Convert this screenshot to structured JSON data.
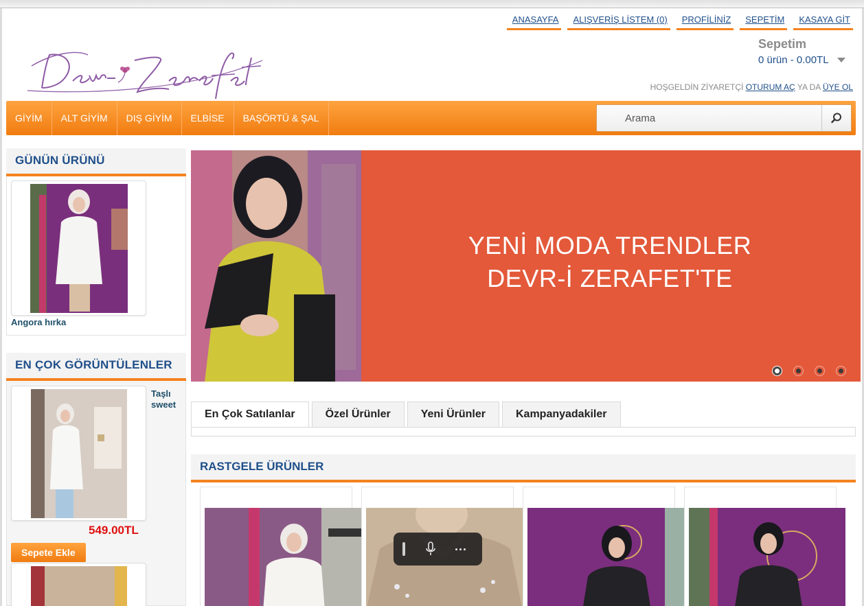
{
  "top_links": [
    {
      "label": "ANASAYFA"
    },
    {
      "label": "ALIŞVERİŞ LİSTEM (0)"
    },
    {
      "label": "PROFİLİNİZ"
    },
    {
      "label": "SEPETİM"
    },
    {
      "label": "KASAYA GİT"
    }
  ],
  "logo": {
    "text": "Devr-i Zerafet"
  },
  "cart": {
    "title": "Sepetim",
    "summary": "0 ürün - 0.00TL"
  },
  "welcome": {
    "prefix": "HOŞGELDİN ZİYARETÇİ",
    "login": "OTURUM AÇ",
    "middle": "YA DA",
    "register": "ÜYE OL"
  },
  "nav": {
    "items": [
      "GİYİM",
      "ALT GİYİM",
      "DIŞ GİYİM",
      "ELBİSE",
      "BAŞÖRTÜ & ŞAL"
    ]
  },
  "search": {
    "placeholder": "Arama"
  },
  "sidebar": {
    "product_of_day": {
      "title": "GÜNÜN ÜRÜNÜ",
      "product_name": "Angora hırka"
    },
    "most_viewed": {
      "title": "EN ÇOK GÖRÜNTÜLENLER",
      "product_name": "Taşlı sweet",
      "price": "549.00TL",
      "add_to_cart": "Sepete Ekle"
    }
  },
  "slider": {
    "line1": "YENİ MODA TRENDLER",
    "line2": "DEVR-İ ZERAFET'TE",
    "slide_count": 4,
    "active_slide": 1
  },
  "tabs": [
    {
      "label": "En Çok Satılanlar",
      "active": true
    },
    {
      "label": "Özel Ürünler",
      "active": false
    },
    {
      "label": "Yeni Ürünler",
      "active": false
    },
    {
      "label": "Kampanyadakiler",
      "active": false
    }
  ],
  "random_products": {
    "title": "RASTGELE ÜRÜNLER"
  },
  "colors": {
    "accent": "#f5821f",
    "link": "#1f4f8a",
    "price": "#e01010",
    "slider_bg": "#e3593a"
  }
}
